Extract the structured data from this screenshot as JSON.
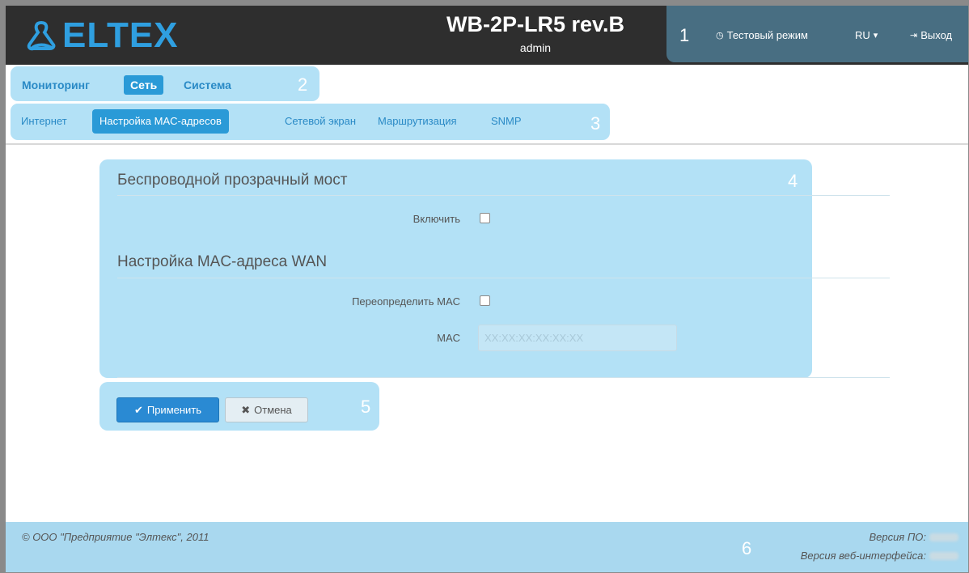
{
  "header": {
    "logo_text": "ELTEX",
    "device_title": "WB-2P-LR5 rev.B",
    "user": "admin",
    "badge": "1",
    "test_mode": "Тестовый режим",
    "lang": "RU",
    "logout": "Выход"
  },
  "nav_main": {
    "badge": "2",
    "items": [
      {
        "label": "Мониторинг",
        "active": false
      },
      {
        "label": "Сеть",
        "active": true
      },
      {
        "label": "Система",
        "active": false
      }
    ]
  },
  "nav_sub": {
    "badge": "3",
    "items": [
      {
        "label": "Интернет",
        "active": false
      },
      {
        "label": "Настройка MAC-адресов",
        "active": true
      },
      {
        "label": "Сетевой экран",
        "active": false
      },
      {
        "label": "Маршрутизация",
        "active": false
      },
      {
        "label": "SNMP",
        "active": false
      }
    ]
  },
  "form": {
    "badge": "4",
    "bridge_title": "Беспроводной прозрачный мост",
    "enable_label": "Включить",
    "wan_title": "Настройка MAC-адреса WAN",
    "override_label": "Переопределить MAC",
    "mac_label": "MAC",
    "mac_placeholder": "XX:XX:XX:XX:XX:XX",
    "mac_value": ""
  },
  "actions": {
    "badge": "5",
    "apply": "Применить",
    "cancel": "Отмена"
  },
  "footer": {
    "badge": "6",
    "copyright": "© ООО \"Предприятие \"Элтекс\", 2011",
    "fw_label": "Версия ПО:",
    "web_label": "Версия веб-интерфейса:"
  },
  "colors": {
    "header_bg": "#2e2e2e",
    "accent": "#2a9ad7",
    "highlight": "#b3e1f6"
  }
}
